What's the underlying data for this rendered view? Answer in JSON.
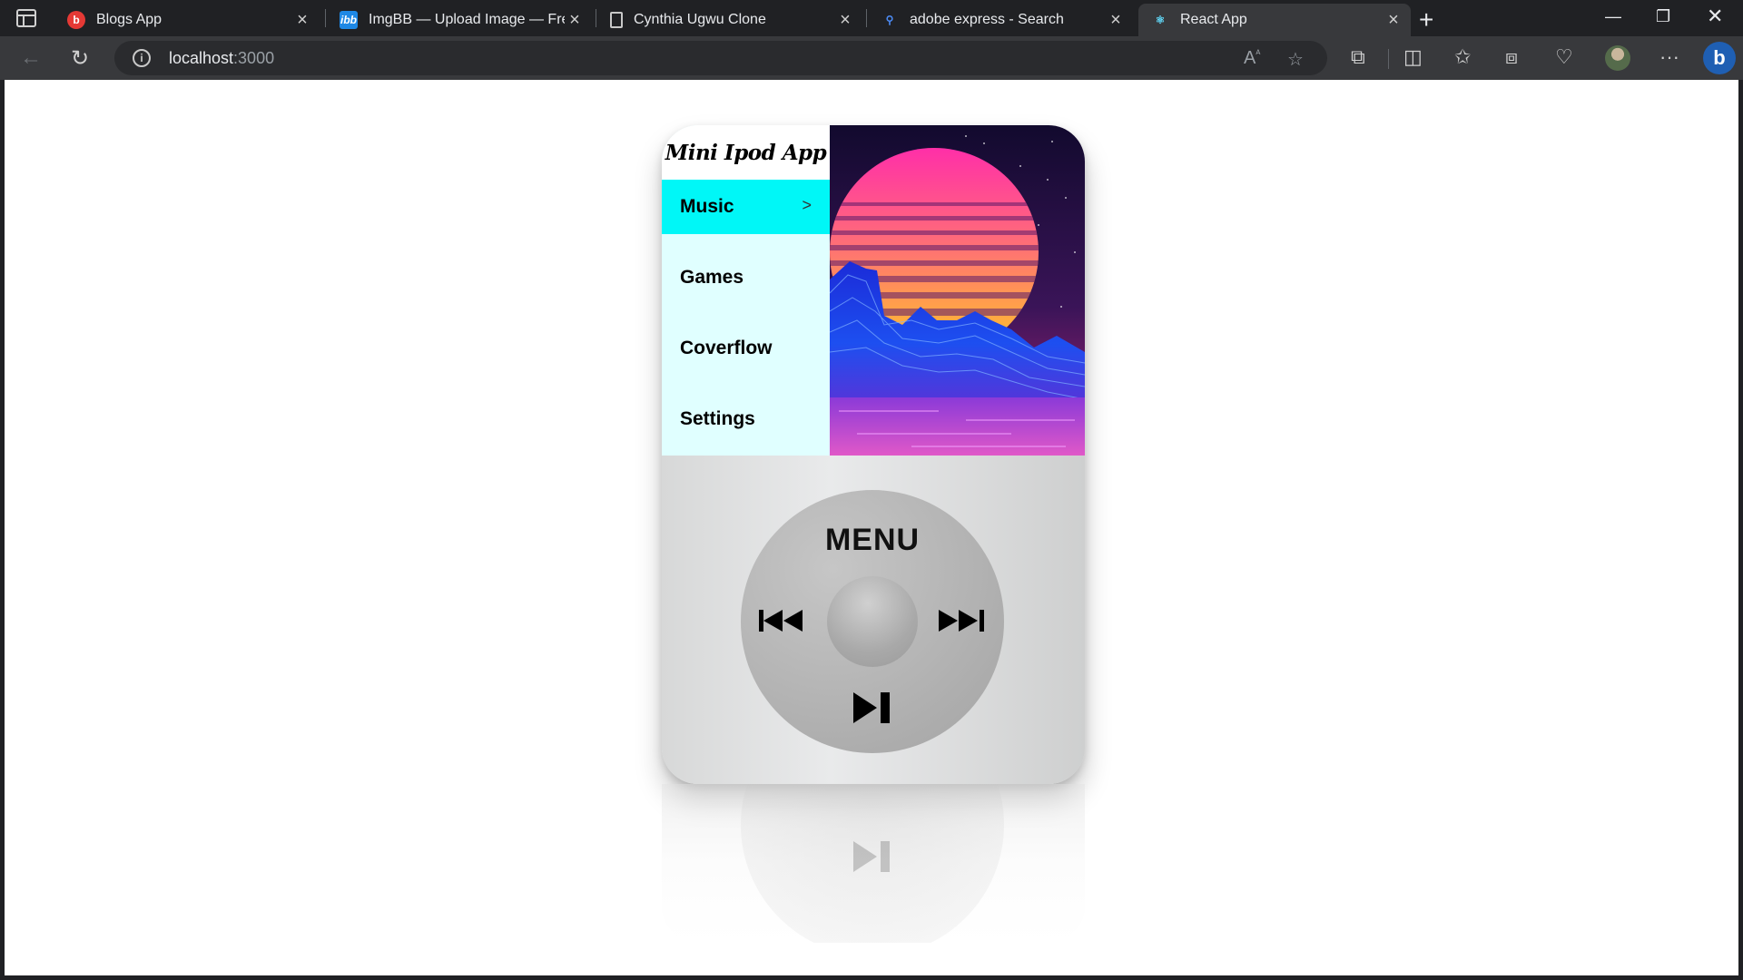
{
  "browser": {
    "tabs": [
      {
        "title": "Blogs App",
        "icon": "blogs-favicon"
      },
      {
        "title": "ImgBB — Upload Image — Free Image Hosting",
        "icon": "imgbb-favicon"
      },
      {
        "title": "Cynthia Ugwu Clone",
        "icon": "page-icon"
      },
      {
        "title": "adobe express - Search",
        "icon": "search-icon"
      },
      {
        "title": "React App",
        "icon": "react-icon"
      }
    ],
    "active_tab": 4,
    "url_host": "localhost",
    "url_port": ":3000"
  },
  "ipod": {
    "title": "Mini Ipod App",
    "menu": [
      {
        "label": "Music",
        "selected": true
      },
      {
        "label": "Games",
        "selected": false
      },
      {
        "label": "Coverflow",
        "selected": false
      },
      {
        "label": "Settings",
        "selected": false
      }
    ],
    "wheel": {
      "menu_label": "MENU",
      "buttons": [
        "previous-icon",
        "next-icon",
        "play-pause-icon"
      ]
    },
    "colors": {
      "menu_bg": "#e0ffff",
      "selected_bg": "#00f7f7",
      "body": "#e0e0e0"
    }
  }
}
